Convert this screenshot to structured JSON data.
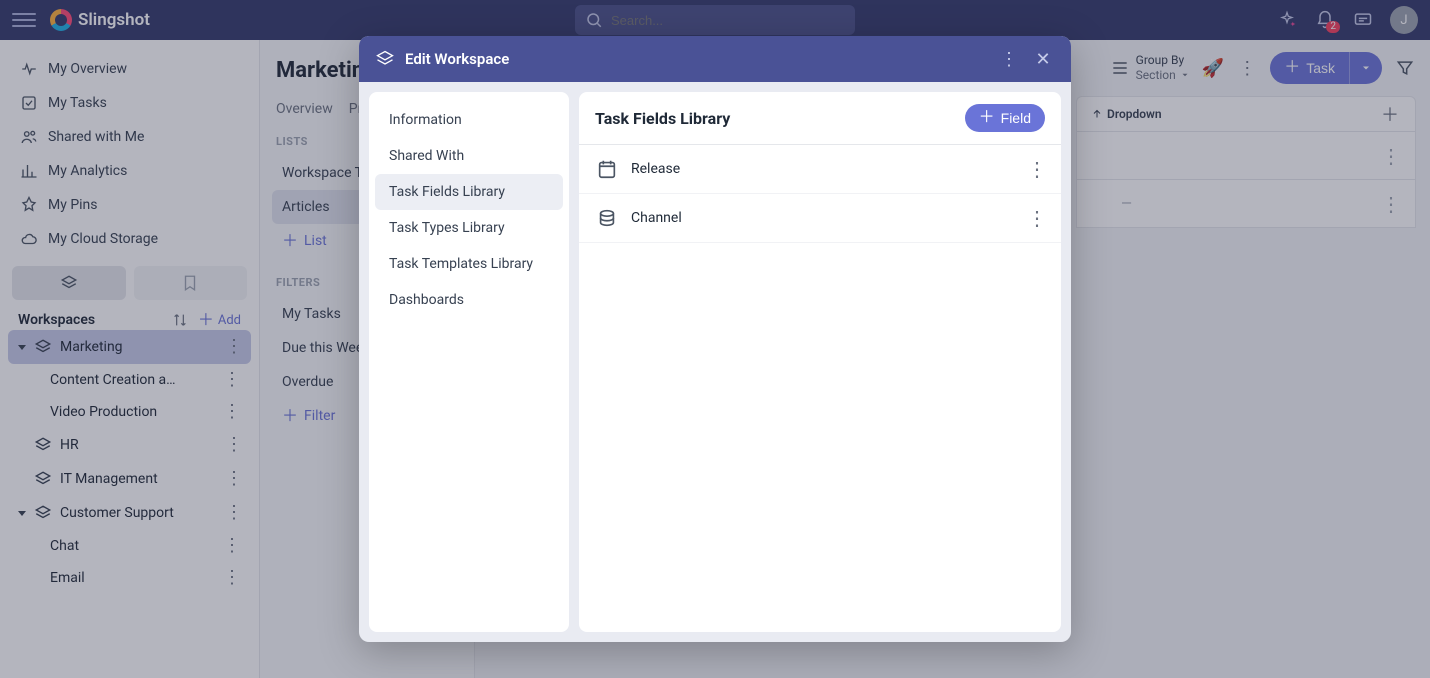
{
  "topbar": {
    "brand": "Slingshot",
    "search_placeholder": "Search...",
    "notif_badge": "2",
    "avatar_initial": "J"
  },
  "leftnav": {
    "items": [
      {
        "label": "My Overview"
      },
      {
        "label": "My Tasks"
      },
      {
        "label": "Shared with Me"
      },
      {
        "label": "My Analytics"
      },
      {
        "label": "My Pins"
      },
      {
        "label": "My Cloud Storage"
      }
    ],
    "workspaces_title": "Workspaces",
    "add_label": "Add",
    "workspaces": [
      {
        "label": "Marketing",
        "expanded": true,
        "selected": true,
        "children": [
          {
            "label": "Content Creation an…"
          },
          {
            "label": "Video Production"
          }
        ]
      },
      {
        "label": "HR",
        "expanded": false
      },
      {
        "label": "IT Management",
        "expanded": false
      },
      {
        "label": "Customer Support",
        "expanded": true,
        "children": [
          {
            "label": "Chat"
          },
          {
            "label": "Email"
          }
        ]
      }
    ]
  },
  "mid": {
    "title": "Marketin",
    "tabs": [
      "Overview",
      "Pr"
    ],
    "lists_hdr": "LISTS",
    "lists": [
      {
        "label": "Workspace T"
      },
      {
        "label": "Articles",
        "selected": true
      }
    ],
    "add_list": "List",
    "filters_hdr": "FILTERS",
    "filters": [
      {
        "label": "My Tasks"
      },
      {
        "label": "Due this Wee"
      },
      {
        "label": "Overdue"
      }
    ],
    "add_filter": "Filter"
  },
  "main": {
    "groupby_label": "Group By",
    "groupby_value": "Section",
    "task_btn": "Task",
    "col_header": "Dropdown",
    "row_placeholder": "—"
  },
  "modal": {
    "title": "Edit Workspace",
    "side": [
      {
        "label": "Information"
      },
      {
        "label": "Shared With"
      },
      {
        "label": "Task Fields Library",
        "selected": true
      },
      {
        "label": "Task Types Library"
      },
      {
        "label": "Task Templates Library"
      },
      {
        "label": "Dashboards"
      }
    ],
    "content_title": "Task Fields Library",
    "field_btn": "Field",
    "fields": [
      {
        "name": "Release",
        "icon": "calendar"
      },
      {
        "name": "Channel",
        "icon": "channel"
      }
    ]
  }
}
